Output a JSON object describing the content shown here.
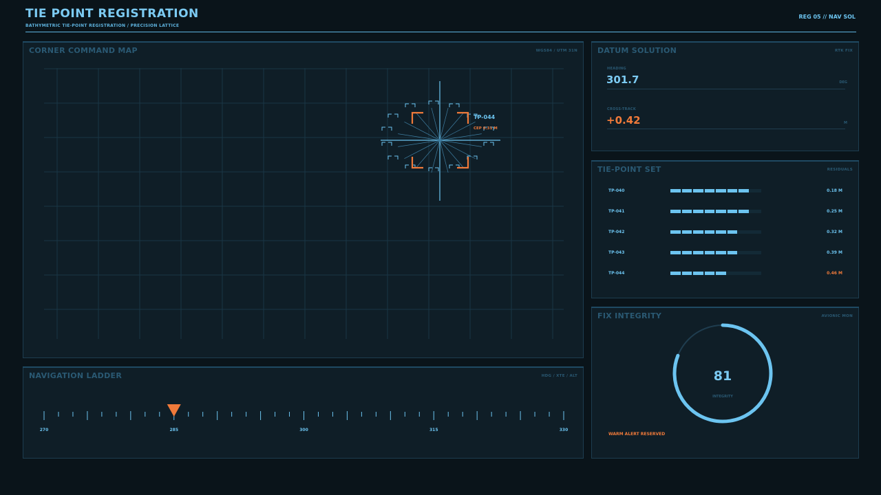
{
  "header": {
    "title": "TIE POINT REGISTRATION",
    "subtitle": "BATHYMETRIC TIE-POINT REGISTRATION / PRECISION LATTICE",
    "reg": "REG 05 // NAV SOL"
  },
  "map": {
    "title": "CORNER COMMAND MAP",
    "tag": "WGS84 / UTM 31N",
    "target_label": "TP-044",
    "cep_label": "CEP 0.31 M"
  },
  "ladder": {
    "title": "NAVIGATION LADDER",
    "tag": "HDG / XTE / ALT",
    "labels": [
      "270",
      "285",
      "300",
      "315",
      "330"
    ],
    "range": [
      270,
      330
    ],
    "current": 285
  },
  "datum": {
    "title": "DATUM SOLUTION",
    "tag": "RTK FIX",
    "heading_label": "HEADING",
    "heading_value": "301.7",
    "heading_unit": "DEG",
    "cross_label": "CROSS-TRACK",
    "cross_value": "+0.42",
    "cross_unit": "M"
  },
  "tieset": {
    "title": "TIE-POINT SET",
    "tag": "RESIDUALS",
    "rows": [
      {
        "name": "TP-040",
        "value": "0.18 M",
        "segments": 7,
        "warn": false
      },
      {
        "name": "TP-041",
        "value": "0.25 M",
        "segments": 7,
        "warn": false
      },
      {
        "name": "TP-042",
        "value": "0.32 M",
        "segments": 6,
        "warn": false
      },
      {
        "name": "TP-043",
        "value": "0.39 M",
        "segments": 6,
        "warn": false
      },
      {
        "name": "TP-044",
        "value": "0.46 M",
        "segments": 5,
        "warn": true
      }
    ],
    "total_segments": 8
  },
  "integrity": {
    "title": "FIX INTEGRITY",
    "tag": "AVIONIC MON",
    "value": "81",
    "value_fraction": 0.81,
    "label": "INTEGRITY",
    "alert": "WARM ALERT RESERVED"
  },
  "colors": {
    "accent": "#6cc4f0",
    "warn": "#f07a3a",
    "panel": "#0f1e27",
    "background": "#0a141a"
  }
}
